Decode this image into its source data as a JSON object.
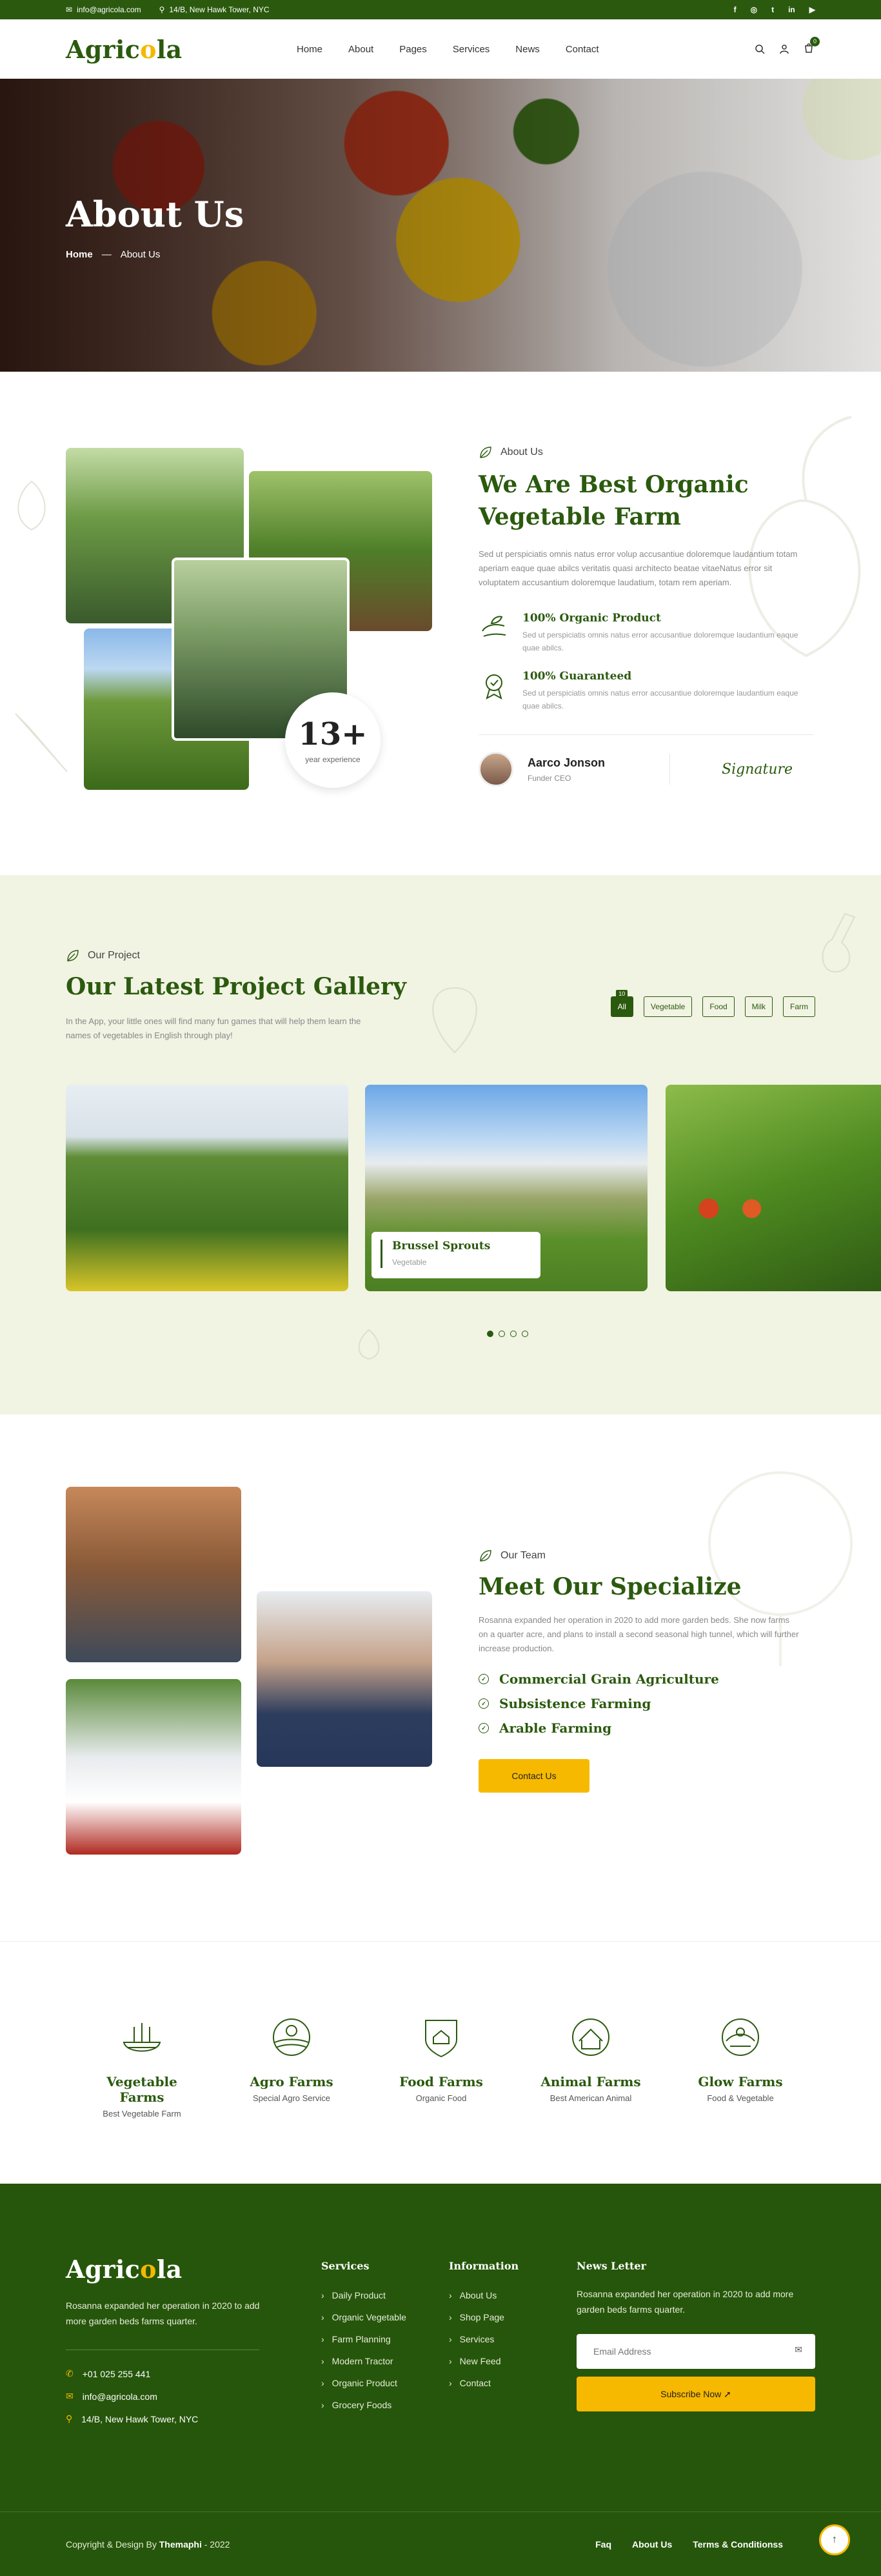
{
  "topbar": {
    "email": "info@agricola.com",
    "address": "14/B, New Hawk Tower, NYC",
    "social": [
      "f",
      "◎",
      "t",
      "in",
      "▶"
    ]
  },
  "header": {
    "logo_pre": "Agric",
    "logo_o": "o",
    "logo_post": "la",
    "nav": [
      "Home",
      "About",
      "Pages",
      "Services",
      "News",
      "Contact"
    ],
    "cart_count": "0"
  },
  "hero": {
    "title": "About Us",
    "crumb_home": "Home",
    "crumb_sep": "—",
    "crumb_current": "About Us"
  },
  "about": {
    "experience_num": "13+",
    "experience_label": "year experience",
    "subtitle": "About Us",
    "title": "We Are Best Organic Vegetable Farm",
    "text": "Sed ut perspiciatis omnis natus error volup accusantiue doloremque laudantium totam aperiam eaque quae abilcs veritatis quasi architecto beatae vitaeNatus error sit voluptatem accusantium doloremque laudatium, totam rem aperiam.",
    "features": [
      {
        "title": "100% Organic Product",
        "text": "Sed ut perspiciatis omnis natus error accusantiue doloremque laudantium eaque quae abilcs."
      },
      {
        "title": "100% Guaranteed",
        "text": "Sed ut perspiciatis omnis natus error accusantiue doloremque laudantium eaque quae abilcs."
      }
    ],
    "ceo_name": "Aarco Jonson",
    "ceo_role": "Funder CEO",
    "signature": "Signature"
  },
  "project": {
    "subtitle": "Our Project",
    "title": "Our Latest Project Gallery",
    "text": "In the App, your little ones will find many fun games that will help them learn the names of vegetables in English through play!",
    "filters": [
      {
        "label": "All",
        "count": "10",
        "active": true
      },
      {
        "label": "Vegetable"
      },
      {
        "label": "Food"
      },
      {
        "label": "Milk"
      },
      {
        "label": "Farm"
      }
    ],
    "card_title": "Brussel Sprouts",
    "card_sub": "Vegetable"
  },
  "team": {
    "subtitle": "Our Team",
    "title": "Meet Our Specialize",
    "text": "Rosanna expanded her operation in 2020 to add more garden beds. She now farms on a quarter acre, and plans to install a second seasonal high tunnel, which will further increase production.",
    "items": [
      "Commercial Grain Agriculture",
      "Subsistence Farming",
      "Arable Farming"
    ],
    "button": "Contact Us"
  },
  "services": [
    {
      "title": "Vegetable Farms",
      "sub": "Best Vegetable Farm"
    },
    {
      "title": "Agro Farms",
      "sub": "Special Agro Service"
    },
    {
      "title": "Food Farms",
      "sub": "Organic Food"
    },
    {
      "title": "Animal Farms",
      "sub": "Best American Animal"
    },
    {
      "title": "Glow Farms",
      "sub": "Food & Vegetable"
    }
  ],
  "footer": {
    "about": "Rosanna expanded her operation in 2020 to add more garden beds farms quarter.",
    "phone": "+01 025 255 441",
    "email": "info@agricola.com",
    "address": "14/B, New Hawk Tower, NYC",
    "services_title": "Services",
    "services": [
      "Daily Product",
      "Organic Vegetable",
      "Farm Planning",
      "Modern Tractor",
      "Organic Product",
      "Grocery Foods"
    ],
    "info_title": "Information",
    "info": [
      "About Us",
      "Shop Page",
      "Services",
      "New Feed",
      "Contact"
    ],
    "news_title": "News Letter",
    "news_text": "Rosanna expanded her operation in 2020 to add more garden beds farms quarter.",
    "email_placeholder": "Email Address",
    "subscribe": "Subscribe Now",
    "copyright_pre": "Copyright & Design By ",
    "copyright_brand": "Themaphi",
    "copyright_post": " - 2022",
    "links": [
      "Faq",
      "About Us",
      "Terms & Conditionss"
    ]
  },
  "colors": {
    "brand_green": "#2b5a0e",
    "accent_yellow": "#f7b900",
    "section_bg": "#f1f3e3"
  }
}
